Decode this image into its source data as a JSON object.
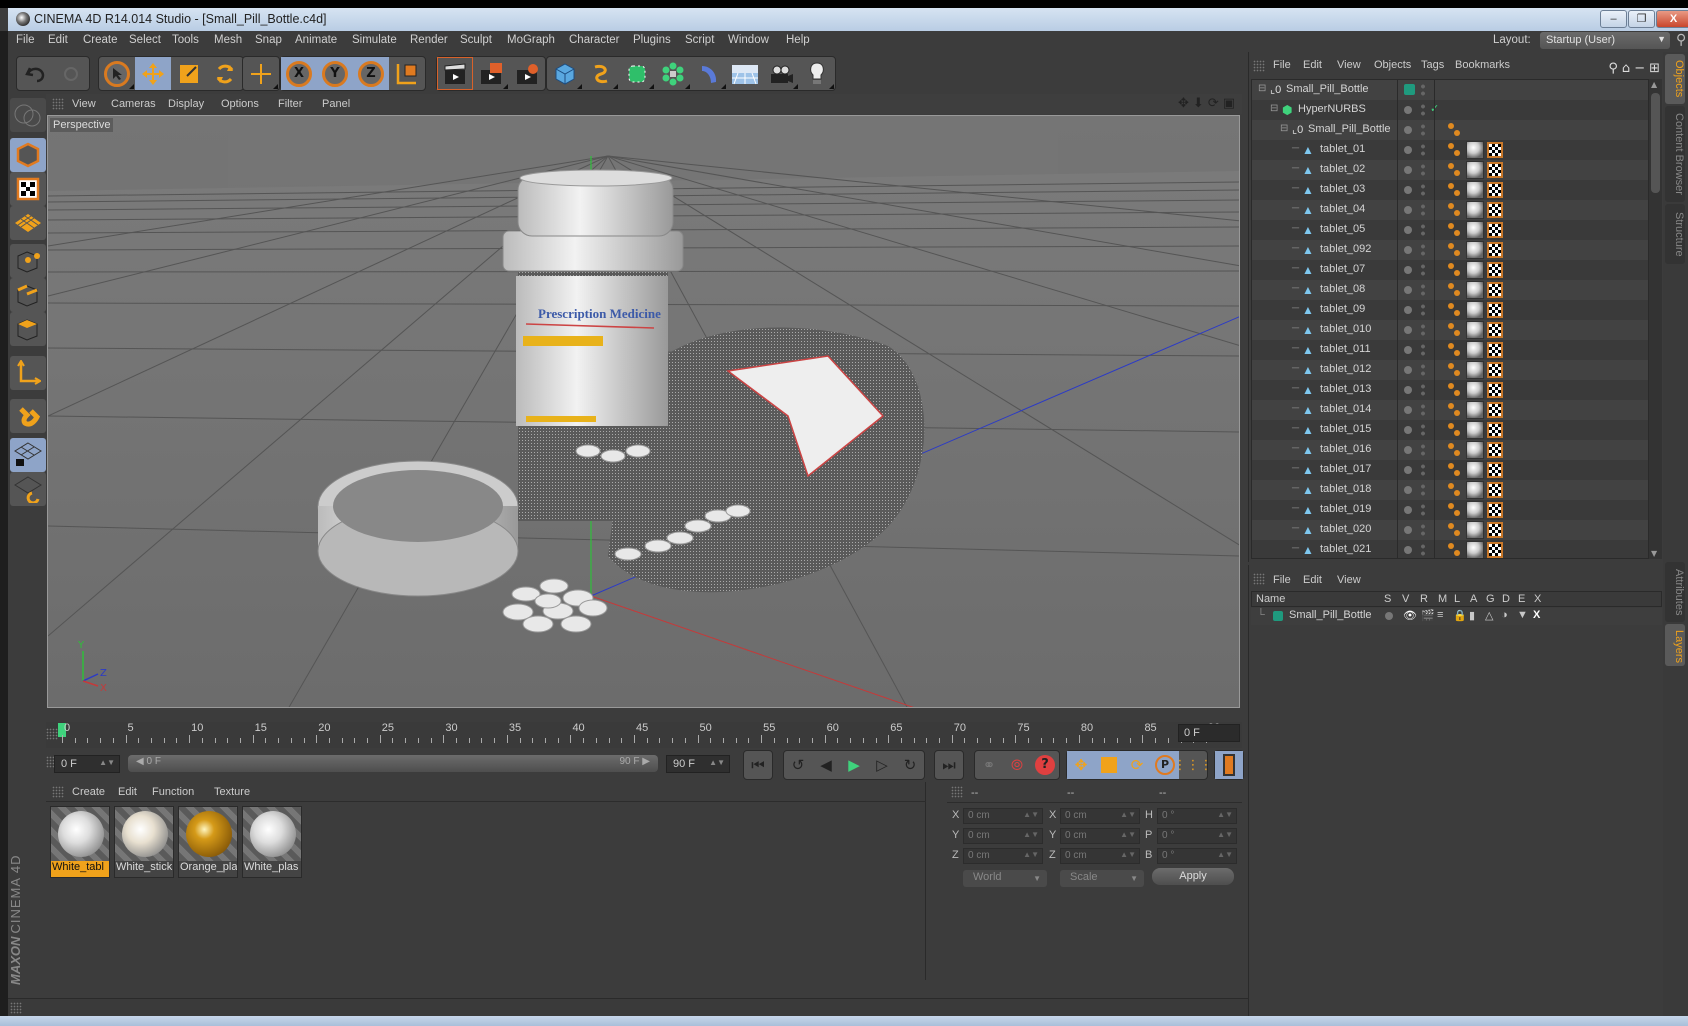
{
  "window": {
    "title": "CINEMA 4D R14.014 Studio - [Small_Pill_Bottle.c4d]",
    "controls": {
      "minimize": "–",
      "restore": "❐",
      "close": "X"
    }
  },
  "menubar": {
    "items": [
      "File",
      "Edit",
      "Create",
      "Select",
      "Tools",
      "Mesh",
      "Snap",
      "Animate",
      "Simulate",
      "Render",
      "Sculpt",
      "MoGraph",
      "Character",
      "Plugins",
      "Script",
      "Window",
      "Help"
    ],
    "layout_label": "Layout:",
    "layout_value": "Startup (User)"
  },
  "toolbar": {
    "groups": [
      [
        "undo-icon",
        "redo-icon"
      ],
      [
        "live-selection-icon",
        "move-icon",
        "scale-icon",
        "rotate-icon"
      ],
      [
        "last-tool-icon"
      ],
      [
        "x-axis-lock-icon",
        "y-axis-lock-icon",
        "z-axis-lock-icon",
        "coordinate-system-icon"
      ],
      [
        "render-view-icon",
        "render-picture-viewer-icon",
        "render-settings-icon"
      ],
      [
        "cube-primitive-icon",
        "spline-pen-icon",
        "nurbs-icon",
        "array-icon",
        "deformer-icon",
        "floor-icon",
        "camera-icon",
        "light-icon"
      ]
    ],
    "axis_labels": [
      "X",
      "Y",
      "Z"
    ]
  },
  "left_tools": [
    "model-mode-icon",
    "texture-mode-icon",
    "workplane-mode-icon",
    "points-mode-icon",
    "edges-mode-icon",
    "polygons-mode-icon",
    "axis-mode-icon",
    "magnet-icon",
    "locked-workplane-icon",
    "planar-workplane-icon"
  ],
  "viewport": {
    "menu": [
      "View",
      "Cameras",
      "Display",
      "Options",
      "Filter",
      "Panel"
    ],
    "camera_label": "Perspective",
    "nav_icons": [
      "pan-icon",
      "dolly-icon",
      "orbit-icon",
      "maximize-view-icon"
    ],
    "label_text": "Prescription Medicine",
    "axis": {
      "y": "Y",
      "z": "Z",
      "x": "X"
    },
    "colors": {
      "y_axis": "#2fbf3a",
      "x_axis": "#c43a3a",
      "z_axis": "#2b3ac7"
    }
  },
  "timeline": {
    "ticks": [
      "0",
      "5",
      "10",
      "15",
      "20",
      "25",
      "30",
      "35",
      "40",
      "45",
      "50",
      "55",
      "60",
      "65",
      "70",
      "75",
      "80",
      "85",
      "90"
    ],
    "current_frame_display": "0 F",
    "start_frame": "0 F",
    "range_start": "0 F",
    "range_end": "90 F",
    "end_frame": "90 F",
    "current_frame": 0,
    "max_frame": 90
  },
  "playback": {
    "buttons": [
      "go-to-start-icon",
      "previous-key-icon",
      "previous-frame-icon",
      "play-icon",
      "next-frame-icon",
      "next-key-icon",
      "go-to-end-icon"
    ],
    "record": [
      "motion-record-icon",
      "record-active-icon",
      "autokey-icon"
    ],
    "keys": [
      "key-position-icon",
      "key-scale-icon",
      "key-rotation-icon",
      "key-parameter-icon",
      "key-pla-icon"
    ],
    "timeline_icon": "timeline-window-icon"
  },
  "materials": {
    "menu": [
      "Create",
      "Edit",
      "Function",
      "Texture"
    ],
    "items": [
      {
        "label": "White_tabl",
        "selected": true,
        "color": "#e8e8e8"
      },
      {
        "label": "White_stick",
        "selected": false,
        "color": "#e0e0e0"
      },
      {
        "label": "Orange_pla",
        "selected": false,
        "color": "#c48a10"
      },
      {
        "label": "White_plas",
        "selected": false,
        "color": "#e0e0e0"
      }
    ]
  },
  "coordinates": {
    "headers": [
      "--",
      "--",
      "--"
    ],
    "rows": [
      {
        "l1": "X",
        "v1": "0 cm",
        "l2": "X",
        "v2": "0 cm",
        "l3": "H",
        "v3": "0 °"
      },
      {
        "l1": "Y",
        "v1": "0 cm",
        "l2": "Y",
        "v2": "0 cm",
        "l3": "P",
        "v3": "0 °"
      },
      {
        "l1": "Z",
        "v1": "0 cm",
        "l2": "Z",
        "v2": "0 cm",
        "l3": "B",
        "v3": "0 °"
      }
    ],
    "space": "World",
    "mode": "Scale",
    "apply": "Apply"
  },
  "brand": {
    "maker": "MAXON",
    "product": "CINEMA 4D"
  },
  "objects": {
    "menu": [
      "File",
      "Edit",
      "View",
      "Objects",
      "Tags",
      "Bookmarks"
    ],
    "tree": [
      {
        "name": "Small_Pill_Bottle",
        "level": 0,
        "type": "null",
        "layer": true
      },
      {
        "name": "HyperNURBS",
        "level": 1,
        "type": "hypernurbs",
        "enabled": true
      },
      {
        "name": "Small_Pill_Bottle",
        "level": 2,
        "type": "null"
      },
      {
        "name": "tablet_01",
        "level": 3,
        "type": "polygon"
      },
      {
        "name": "tablet_02",
        "level": 3,
        "type": "polygon"
      },
      {
        "name": "tablet_03",
        "level": 3,
        "type": "polygon"
      },
      {
        "name": "tablet_04",
        "level": 3,
        "type": "polygon"
      },
      {
        "name": "tablet_05",
        "level": 3,
        "type": "polygon"
      },
      {
        "name": "tablet_092",
        "level": 3,
        "type": "polygon"
      },
      {
        "name": "tablet_07",
        "level": 3,
        "type": "polygon"
      },
      {
        "name": "tablet_08",
        "level": 3,
        "type": "polygon"
      },
      {
        "name": "tablet_09",
        "level": 3,
        "type": "polygon"
      },
      {
        "name": "tablet_010",
        "level": 3,
        "type": "polygon"
      },
      {
        "name": "tablet_011",
        "level": 3,
        "type": "polygon"
      },
      {
        "name": "tablet_012",
        "level": 3,
        "type": "polygon"
      },
      {
        "name": "tablet_013",
        "level": 3,
        "type": "polygon"
      },
      {
        "name": "tablet_014",
        "level": 3,
        "type": "polygon"
      },
      {
        "name": "tablet_015",
        "level": 3,
        "type": "polygon"
      },
      {
        "name": "tablet_016",
        "level": 3,
        "type": "polygon"
      },
      {
        "name": "tablet_017",
        "level": 3,
        "type": "polygon"
      },
      {
        "name": "tablet_018",
        "level": 3,
        "type": "polygon"
      },
      {
        "name": "tablet_019",
        "level": 3,
        "type": "polygon"
      },
      {
        "name": "tablet_020",
        "level": 3,
        "type": "polygon"
      },
      {
        "name": "tablet_021",
        "level": 3,
        "type": "polygon"
      }
    ]
  },
  "layers": {
    "menu": [
      "File",
      "Edit",
      "View"
    ],
    "columns": [
      "Name",
      "S",
      "V",
      "R",
      "M",
      "L",
      "A",
      "G",
      "D",
      "E",
      "X"
    ],
    "rows": [
      {
        "name": "Small_Pill_Bottle",
        "color": "#1f9a7e"
      }
    ]
  },
  "side_tabs": {
    "top": [
      {
        "label": "Objects",
        "active": true
      },
      {
        "label": "Content Browser",
        "active": false
      },
      {
        "label": "Structure",
        "active": false
      }
    ],
    "bottom": [
      {
        "label": "Attributes",
        "active": false
      },
      {
        "label": "Layers",
        "active": true
      }
    ]
  },
  "colors": {
    "accent": "#f0a21b",
    "selected_tool": "#8ea4c8",
    "play": "#3fd27c"
  }
}
